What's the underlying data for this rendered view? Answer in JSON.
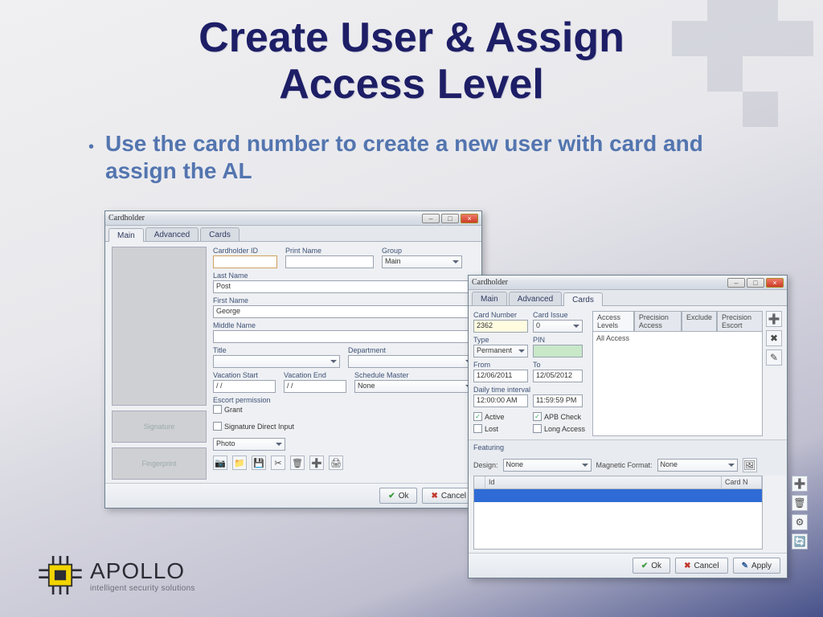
{
  "slide": {
    "title_l1": "Create User & Assign",
    "title_l2": "Access Level",
    "bullet1": "Use the card number to create a new user with card and assign the AL"
  },
  "logo": {
    "brand": "APOLLO",
    "tagline": "intelligent security solutions"
  },
  "dlg1": {
    "title": "Cardholder",
    "tabs": [
      "Main",
      "Advanced",
      "Cards"
    ],
    "labels": {
      "cardholder_id": "Cardholder ID",
      "print_name": "Print Name",
      "group": "Group",
      "last_name": "Last Name",
      "first_name": "First Name",
      "middle_name": "Middle Name",
      "title": "Title",
      "department": "Department",
      "vac_start": "Vacation Start",
      "vac_end": "Vacation End",
      "sched_master": "Schedule Master",
      "escort": "Escort permission",
      "grant": "Grant",
      "sig_direct": "Signature Direct Input",
      "signature": "Signature",
      "fingerprint": "Fingerprint"
    },
    "values": {
      "cardholder_id": "",
      "print_name": "",
      "group": "Main",
      "last_name": "Post",
      "first_name": "George",
      "middle_name": "",
      "title": "",
      "department": "",
      "vac_start": "/  /",
      "vac_end": "/  /",
      "sched_master": "None",
      "photo_type": "Photo"
    },
    "buttons": {
      "ok": "Ok",
      "cancel": "Cancel"
    }
  },
  "dlg2": {
    "title": "Cardholder",
    "tabs": [
      "Main",
      "Advanced",
      "Cards"
    ],
    "al_tabs": [
      "Access Levels",
      "Precision Access",
      "Exclude",
      "Precision Escort"
    ],
    "labels": {
      "card_number": "Card Number",
      "card_issue": "Card Issue",
      "type": "Type",
      "pin": "PIN",
      "from": "From",
      "to": "To",
      "daily": "Daily time interval",
      "active": "Active",
      "apb": "APB Check",
      "lost": "Lost",
      "long": "Long Access",
      "featuring": "Featuring",
      "design": "Design:",
      "magfmt": "Magnetic Format:"
    },
    "values": {
      "card_number": "2362",
      "card_issue": "0",
      "type": "Permanent",
      "pin": "",
      "from": "12/06/2011",
      "to": "12/05/2012",
      "daily_from": "12:00:00 AM",
      "daily_to": "11:59:59 PM",
      "design": "None",
      "magfmt": "None",
      "al_item": "All Access"
    },
    "checks": {
      "active": true,
      "apb": true,
      "lost": false,
      "long": false
    },
    "grid": {
      "col_id": "Id",
      "col_card": "Card N"
    },
    "buttons": {
      "ok": "Ok",
      "cancel": "Cancel",
      "apply": "Apply"
    }
  }
}
